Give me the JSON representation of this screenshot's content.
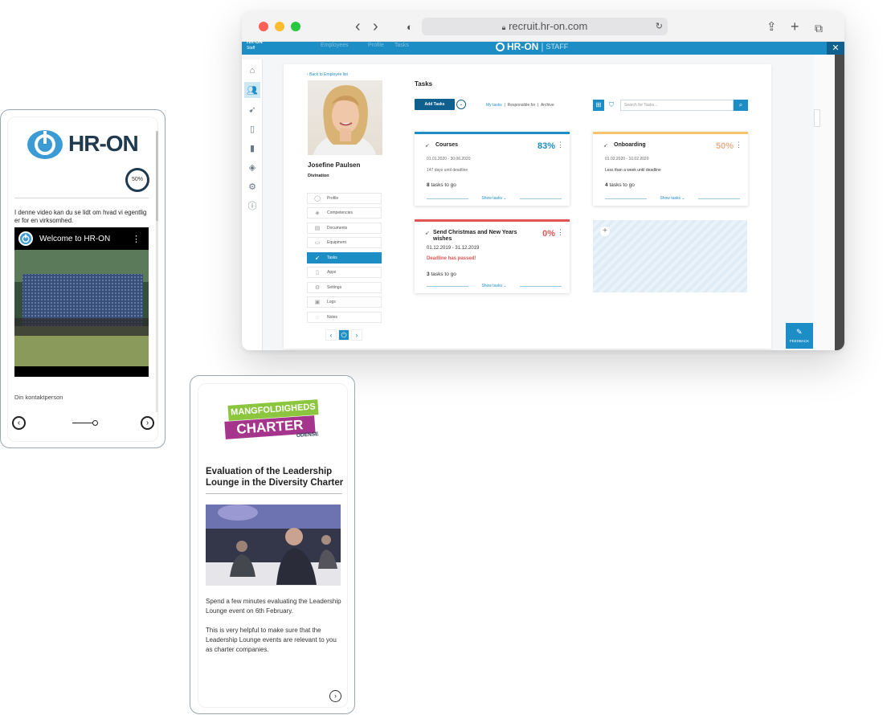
{
  "browser": {
    "url": "recruit.hr-on.com",
    "colors": {
      "close": "#fe5f57",
      "minimize": "#febc2e",
      "zoom": "#28c840",
      "brand": "#1c8dc5"
    },
    "app_header": {
      "brand": "HR-ON",
      "product": "STAFF",
      "left_label": "HR-ON",
      "left_sub": "Staff",
      "nav": [
        "Employees",
        "Profile",
        "Tasks"
      ]
    }
  },
  "sidebar": {
    "icons": [
      "home-icon",
      "users-icon",
      "rocket-icon",
      "phone-icon",
      "battery-icon",
      "graduation-icon",
      "settings-icon",
      "info-icon"
    ]
  },
  "employee": {
    "back_label": "Back to Employee list",
    "name": "Josefine Paulsen",
    "company": "Divination",
    "menu": [
      "Profile",
      "Competencies",
      "Documents",
      "Equipment",
      "Tasks",
      "Apps",
      "Settings",
      "Logs",
      "Notes"
    ],
    "active_menu": "Tasks"
  },
  "tasks": {
    "title": "Tasks",
    "add_button": "Add Tasks",
    "filters": [
      "My tasks",
      "Responsible for",
      "Archive"
    ],
    "search_placeholder": "Search for Tasks...",
    "cards": [
      {
        "title": "Courses",
        "percent": "83%",
        "dates": "01.01.2020 - 30.06.2020",
        "note": "147 days until deadline",
        "count": "8",
        "count_suffix": "tasks to go",
        "show": "Show tasks",
        "color": "#1c8dc5"
      },
      {
        "title": "Onboarding",
        "percent": "50%",
        "dates": "01.02.2020 - 10.02.2020",
        "note": "Less than a week until deadline",
        "count": "4",
        "count_suffix": "tasks to go",
        "show": "Show tasks",
        "color": "#f5c46a"
      },
      {
        "title": "Send Christmas and New Years wishes",
        "percent": "0%",
        "dates": "01.12.2019 - 31.12.2019",
        "note": "Deadline has passed!",
        "count": "3",
        "count_suffix": "tasks to go",
        "show": "Show tasks",
        "color": "#e05656"
      }
    ],
    "feedback": "FEEDBACK"
  },
  "phone1": {
    "logo_text": "HR-ON",
    "progress": "50%",
    "intro": "I denne video kan du se lidt om hvad vi egentlig er for en virksomhed.",
    "video_title": "Welcome to HR-ON",
    "contact": "Din kontaktperson"
  },
  "phone2": {
    "badge_line1": "MANGFOLDIGHEDS",
    "badge_line2": "CHARTER",
    "badge_line3": "ODENSE",
    "title": "Evaluation of the Leadership Lounge in the Diversity Charter",
    "body1": "Spend a few minutes evaluating the Leadership Lounge event on 6th February.",
    "body2": "This is very helpful to make sure that the Leadership Lounge events are relevant to you as charter companies."
  }
}
